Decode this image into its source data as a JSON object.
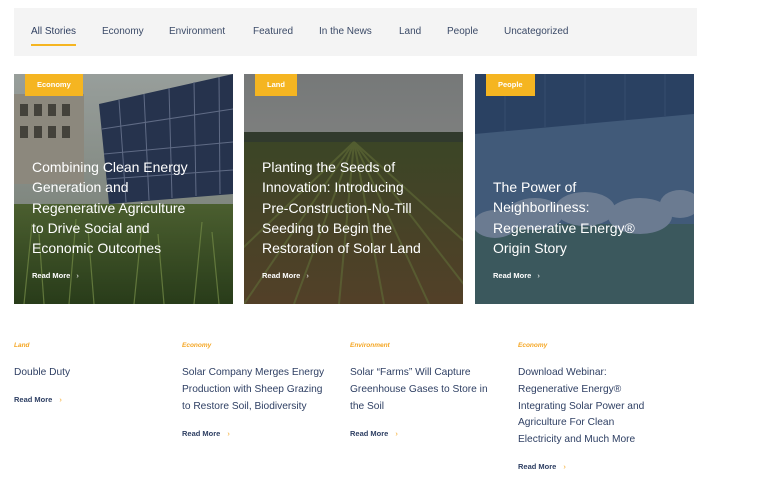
{
  "filters": {
    "tabs": [
      "All Stories",
      "Economy",
      "Environment",
      "Featured",
      "In the News",
      "Land",
      "People",
      "Uncategorized"
    ],
    "active": "All Stories"
  },
  "featured": [
    {
      "category": "Economy",
      "title_lines": [
        "Combining Clean Energy",
        "Generation and",
        "Regenerative Agriculture",
        "to Drive Social and",
        "Economic Outcomes"
      ],
      "read_more": "Read More"
    },
    {
      "category": "Land",
      "title_lines": [
        "Planting the Seeds of",
        "Innovation: Introducing",
        "Pre-Construction-No-Till",
        "Seeding to Begin the",
        "Restoration of Solar Land"
      ],
      "read_more": "Read More"
    },
    {
      "category": "People",
      "title_lines": [
        "The Power of",
        "Neighborliness:",
        "Regenerative Energy®",
        "Origin Story"
      ],
      "read_more": "Read More"
    }
  ],
  "stories": [
    {
      "category": "Land",
      "title_lines": [
        "Double Duty"
      ],
      "read_more": "Read More"
    },
    {
      "category": "Economy",
      "title_lines": [
        "Solar Company Merges Energy",
        "Production with Sheep Grazing",
        "to Restore Soil, Biodiversity"
      ],
      "read_more": "Read More"
    },
    {
      "category": "Environment",
      "title_lines": [
        "Solar “Farms” Will Capture",
        "Greenhouse Gases to Store in",
        "the Soil"
      ],
      "read_more": "Read More"
    },
    {
      "category": "Economy",
      "title_lines": [
        "Download Webinar:",
        "Regenerative Energy®",
        "Integrating Solar Power and",
        "Agriculture For Clean",
        "Electricity and Much More"
      ],
      "read_more": "Read More"
    }
  ],
  "colors": {
    "accent": "#f5b521",
    "text_dark": "#2e3f63"
  },
  "icons": {
    "chevron": "chevron-right-icon"
  }
}
